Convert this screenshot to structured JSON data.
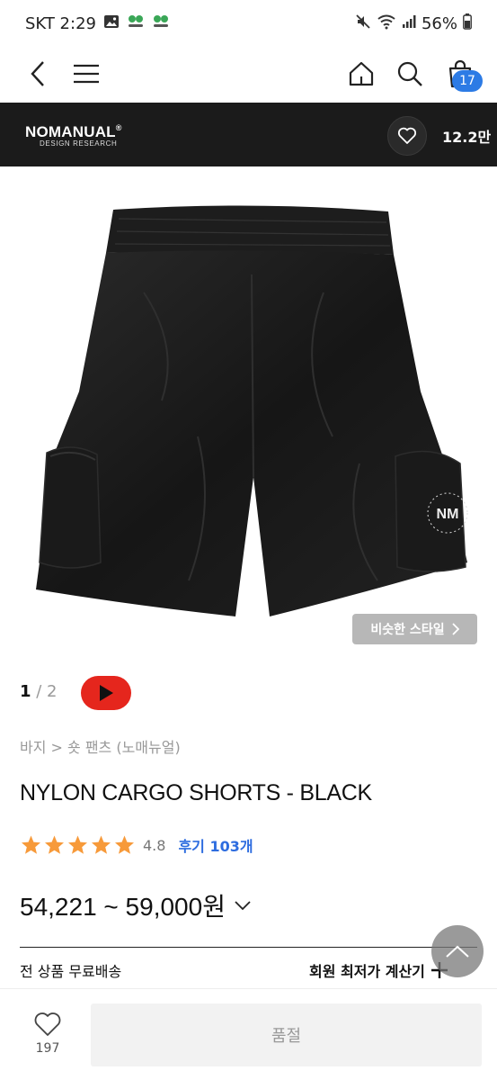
{
  "status": {
    "carrier_time": "SKT 2:29",
    "battery": "56%"
  },
  "header": {
    "cart_count": "17"
  },
  "brand": {
    "name": "NOMANUAL",
    "sub": "DESIGN RESEARCH",
    "likes": "12.2만"
  },
  "image": {
    "similar_style": "비슷한 스타일"
  },
  "pager": {
    "current": "1",
    "rest": " / 2"
  },
  "product": {
    "breadcrumb": "바지 > 숏 팬츠 (노매뉴얼)",
    "title": "NYLON CARGO SHORTS - BLACK",
    "rating": "4.8",
    "stars": 5,
    "reviews": "후기 103개",
    "price": "54,221 ~ 59,000원"
  },
  "info": {
    "shipping": "전 상품 무료배송",
    "member_calc": "회원 최저가 계산기"
  },
  "bottom": {
    "wish_count": "197",
    "soldout_label": "품절"
  },
  "colors": {
    "accent_blue": "#2c7be5",
    "star": "#f79a3a",
    "youtube": "#e5261d",
    "brand_bar": "#1b1b1b"
  }
}
